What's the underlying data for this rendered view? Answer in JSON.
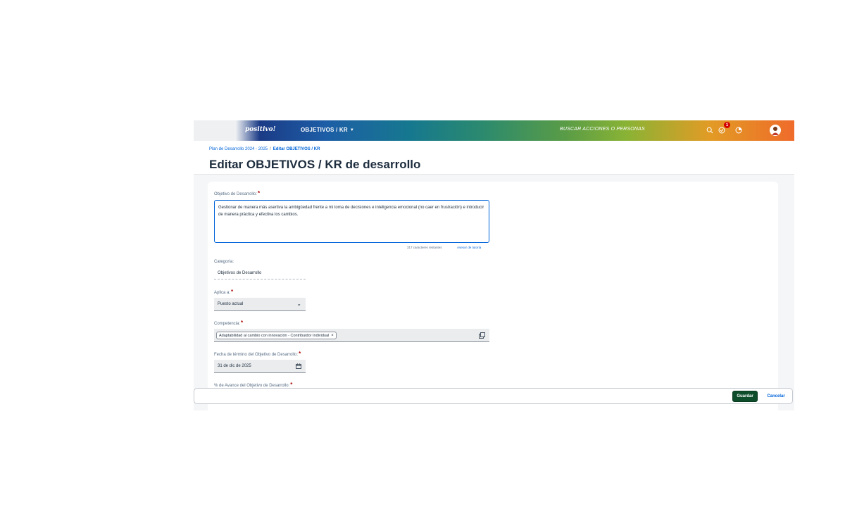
{
  "shell": {
    "logo": "positivo!",
    "nav_menu": "OBJETIVOS / KR",
    "search_placeholder": "BUSCAR ACCIONES O PERSONAS",
    "notification_count": "1",
    "icons": [
      "search-icon",
      "notification-icon",
      "approvals-icon",
      "avatar"
    ]
  },
  "header": {
    "breadcrumb": {
      "parent": "Plan de Desarrollo 2024 - 2025",
      "current": "Editar OBJETIVOS / KR"
    },
    "title": "Editar OBJETIVOS / KR de desarrollo"
  },
  "form": {
    "objective": {
      "label": "Objetivo de Desarrollo:",
      "value": "Gestionar de manera más asertiva la ambigüedad frente a mi toma de decisiones e inteligencia emocional (no caer en frustración) e introducir de manera práctica y efectiva los cambios.",
      "counter": "317 caracteres restantes",
      "tutor_link": "Asesor de tutoría"
    },
    "category": {
      "label": "Categoría:",
      "value": "Objetivos de Desarrollo"
    },
    "applies_to": {
      "label": "Aplica a:",
      "value": "Puesto actual"
    },
    "competency": {
      "label": "Competencia:",
      "token": "Adaptabilidad al cambio con innovación - Contribuidor Individual"
    },
    "end_date": {
      "label": "Fecha de término del Objetivo de Desarrollo:",
      "value": "31 de dic de 2025"
    },
    "progress": {
      "label": "% de Avance del Objetivo de Desarrollo:"
    }
  },
  "footer": {
    "save_label": "Guardar",
    "cancel_label": "Cancelar"
  }
}
